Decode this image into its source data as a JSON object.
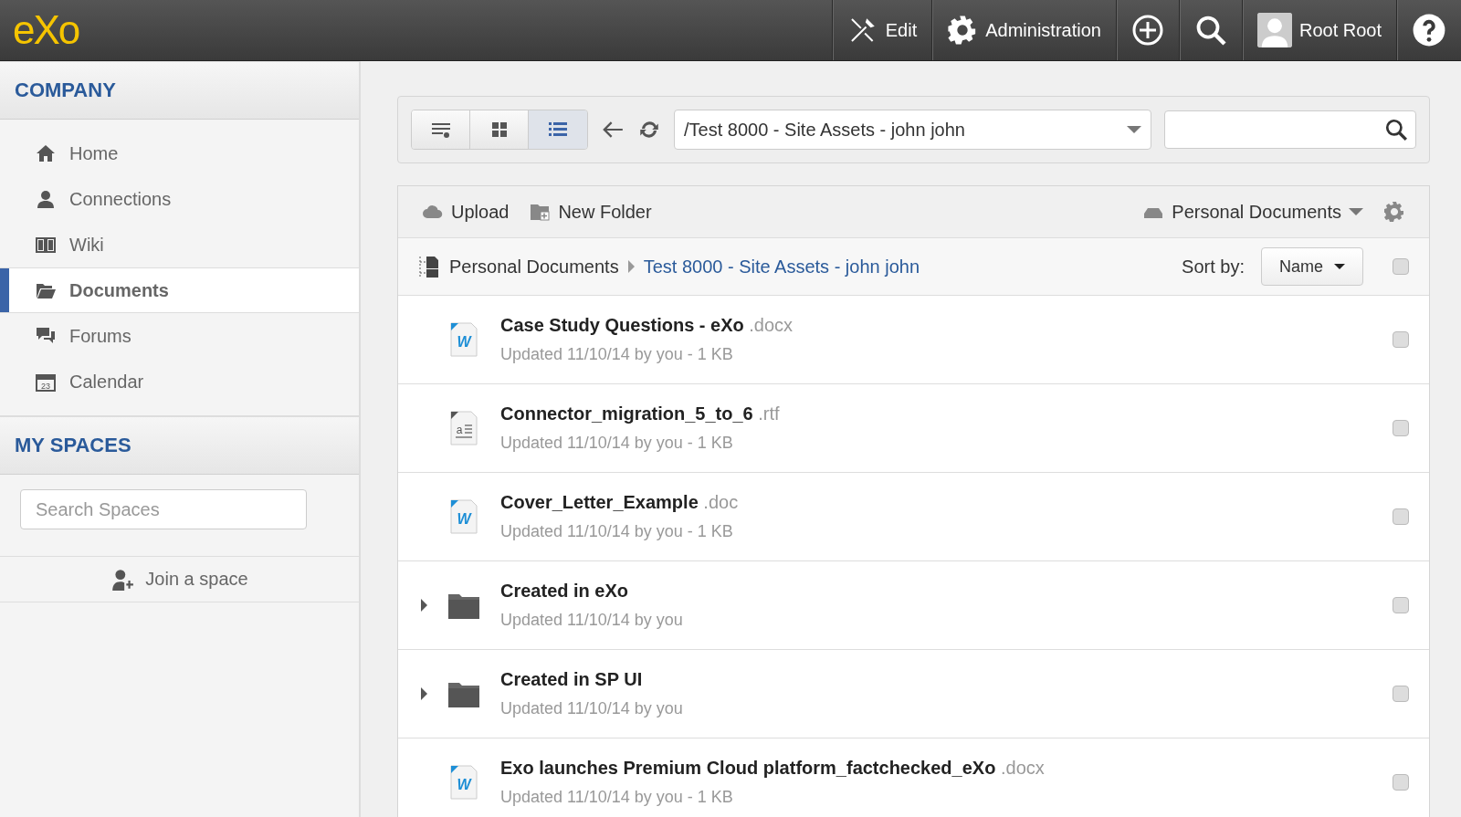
{
  "topbar": {
    "logo": "eXo",
    "items": [
      {
        "kind": "edit",
        "label": "Edit"
      },
      {
        "kind": "admin",
        "label": "Administration"
      },
      {
        "kind": "add"
      },
      {
        "kind": "search"
      },
      {
        "kind": "user",
        "label": "Root Root"
      },
      {
        "kind": "help"
      }
    ]
  },
  "sidebar": {
    "company_title": "COMPANY",
    "items": [
      {
        "label": "Home",
        "selected": false
      },
      {
        "label": "Connections",
        "selected": false
      },
      {
        "label": "Wiki",
        "selected": false
      },
      {
        "label": "Documents",
        "selected": true
      },
      {
        "label": "Forums",
        "selected": false
      },
      {
        "label": "Calendar",
        "selected": false,
        "icon_text": "23"
      }
    ],
    "spaces_title": "MY SPACES",
    "search": {
      "placeholder": "Search Spaces"
    },
    "join": "Join a space"
  },
  "toolbar": {
    "views": [
      {
        "selected": false
      },
      {
        "selected": false
      },
      {
        "selected": true
      }
    ],
    "path": "/Test 8000 - Site Assets - john john"
  },
  "actions": {
    "upload": "Upload",
    "new_folder": "New Folder",
    "drive": "Personal Documents"
  },
  "breadcrumb": {
    "root": "Personal Documents",
    "current": "Test 8000 - Site Assets - john john",
    "sort_label": "Sort by:",
    "sort_value": "Name",
    "select_all": false
  },
  "files": [
    {
      "kind": "word",
      "icon_text": "W",
      "name": "Case Study Questions - eXo",
      "ext": ".docx",
      "meta": "Updated 11/10/14 by you - 1 KB",
      "checked": false
    },
    {
      "kind": "text",
      "icon_text": "a",
      "name": "Connector_migration_5_to_6",
      "ext": ".rtf",
      "meta": "Updated 11/10/14 by you - 1 KB",
      "checked": false
    },
    {
      "kind": "word",
      "icon_text": "W",
      "name": "Cover_Letter_Example",
      "ext": ".doc",
      "meta": "Updated 11/10/14 by you - 1 KB",
      "checked": false
    },
    {
      "kind": "folder",
      "name": "Created in eXo",
      "meta": "Updated 11/10/14 by you",
      "checked": false
    },
    {
      "kind": "folder",
      "name": "Created in SP UI",
      "meta": "Updated 11/10/14 by you",
      "checked": false
    },
    {
      "kind": "word",
      "icon_text": "W",
      "name": "Exo launches Premium Cloud platform_factchecked_eXo",
      "ext": ".docx",
      "meta": "Updated 11/10/14 by you - 1 KB",
      "checked": false
    }
  ]
}
